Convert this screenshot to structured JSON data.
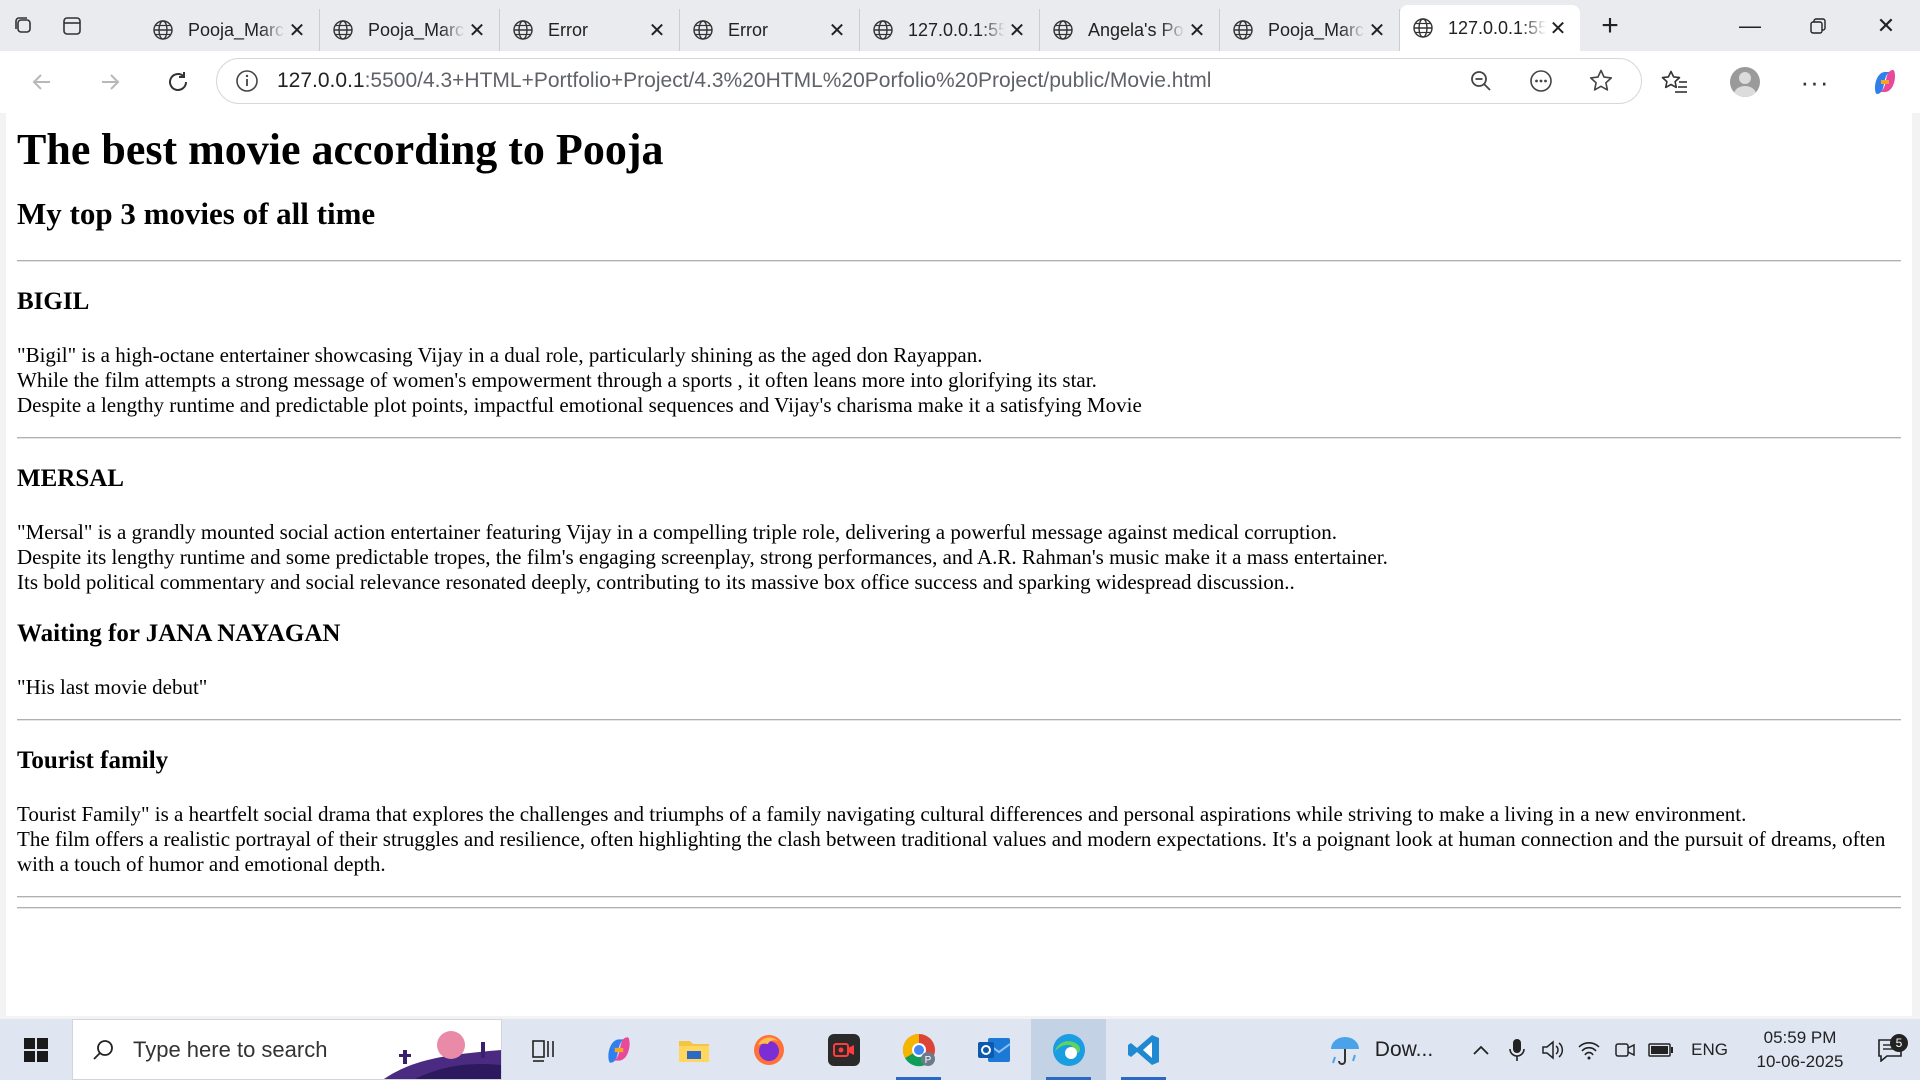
{
  "browser": {
    "tabs": [
      {
        "title": "Pooja_Marc"
      },
      {
        "title": "Pooja_Marc"
      },
      {
        "title": "Error"
      },
      {
        "title": "Error"
      },
      {
        "title": "127.0.0.1:55"
      },
      {
        "title": "Angela's Po"
      },
      {
        "title": "Pooja_Marc"
      },
      {
        "title": "127.0.0.1:55",
        "active": true
      }
    ],
    "url_host": "127.0.0.1",
    "url_path": ":5500/4.3+HTML+Portfolio+Project/4.3%20HTML%20Porfolio%20Project/public/Movie.html"
  },
  "page": {
    "title": "The best movie according to Pooja",
    "subtitle": "My top 3 movies of all time",
    "sections": [
      {
        "heading": "BIGIL",
        "lines": [
          "\"Bigil\" is a high-octane entertainer showcasing Vijay in a dual role, particularly shining as the aged don Rayappan.",
          "While the film attempts a strong message of women's empowerment through a sports , it often leans more into glorifying its star.",
          "Despite a lengthy runtime and predictable plot points, impactful emotional sequences and Vijay's charisma make it a satisfying Movie"
        ]
      },
      {
        "heading": "MERSAL",
        "lines": [
          "\"Mersal\" is a grandly mounted social action entertainer featuring Vijay in a compelling triple role, delivering a powerful message against medical corruption.",
          "Despite its lengthy runtime and some predictable tropes, the film's engaging screenplay, strong performances, and A.R. Rahman's music make it a mass entertainer.",
          "Its bold political commentary and social relevance resonated deeply, contributing to its massive box office success and sparking widespread discussion.."
        ]
      },
      {
        "heading": "Waiting for JANA NAYAGAN",
        "lines": [
          "\"His last movie debut\""
        ]
      },
      {
        "heading": "Tourist family",
        "lines": [
          "Tourist Family\" is a heartfelt social drama that explores the challenges and triumphs of a family navigating cultural differences and personal aspirations while striving to make a living in a new environment.",
          "The film offers a realistic portrayal of their struggles and resilience, often highlighting the clash between traditional values and modern expectations. It's a poignant look at human connection and the pursuit of dreams, often with a touch of humor and emotional depth."
        ]
      }
    ]
  },
  "taskbar": {
    "search_placeholder": "Type here to search",
    "weather_text": "Dow...",
    "language": "ENG",
    "time": "05:59 PM",
    "date": "10-06-2025",
    "notification_count": "5"
  }
}
